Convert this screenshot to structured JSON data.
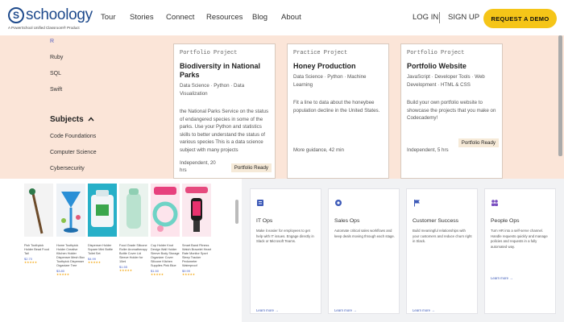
{
  "header": {
    "logo_letter": "S",
    "logo_word": "schoology",
    "logo_sub": "A PowerSchool Unified Classroom® Product",
    "nav": [
      "Tour",
      "Stories",
      "Connect",
      "Resources",
      "Blog",
      "About"
    ],
    "login": "LOG IN",
    "signup": "SIGN UP",
    "cta": "REQUEST A DEMO",
    "cta_color": "#f5c518"
  },
  "filters": {
    "languages": [
      "R",
      "Ruby",
      "SQL",
      "Swift"
    ],
    "subjects_heading": "Subjects",
    "subjects": [
      "Code Foundations",
      "Computer Science",
      "Cybersecurity"
    ]
  },
  "projects": [
    {
      "kind": "Portfolio Project",
      "title": "Biodiversity in National Parks",
      "tags": "Data Science · Python · Data Visualization",
      "desc": "the National Parks Service on the status of endangered species in some of the parks. Use your Python and statistics skills to better understand the status of various species This is a data science subject with many projects",
      "foot": "Independent, 20 hrs",
      "badge": "Portfolio Ready"
    },
    {
      "kind": "Practice Project",
      "title": "Honey Production",
      "tags": "Data Science · Python · Machine Learning",
      "desc": "Fit a line to data about the honeybee population decline in the United States.",
      "foot": "More guidance, 42 min",
      "badge": ""
    },
    {
      "kind": "Portfolio Project",
      "title": "Portfolio Website",
      "tags": "JavaScript · Developer Tools · Web Development · HTML & CSS",
      "desc": "Build your own portfolio website to showcase the projects that you make on Codecademy!",
      "foot": "Independent, 5 hrs",
      "badge": "Portfolio Ready"
    }
  ],
  "products": [
    {
      "title": "Fish Toothpick Holder Bead Food Tail",
      "price": "$2.70",
      "stars": "★★★★★"
    },
    {
      "title": "Home Toothpick Holder Creative Kitchen Holder Dispenser Mesh Box Toothpick Dispenser Organizer Tree",
      "price": "$3.80",
      "stars": "★★★★★"
    },
    {
      "title": "Dispenser Holder Square Mini Bottle Toilet Set",
      "price": "$4.99",
      "stars": "★★★★★"
    },
    {
      "title": "Food Grade Silicone Roller Aromatherapy Bottle Cover Lid Sleeve Holder for 10ml",
      "price": "$1.55",
      "stars": "★★★★★"
    },
    {
      "title": "Cup Holder Knot Design Wall Holder Sleeve Body Storage Organizer Cover Silicone Kitchen Supplies Pink Blue",
      "price": "$1.50",
      "stars": "★★★★★"
    },
    {
      "title": "Smart Band Fitness Watch Bracelet Heart Rate Monitor Sport Sleep Tracker Pedometer Waterproof",
      "price": "$9.99",
      "stars": "★★★★★"
    }
  ],
  "tools": [
    {
      "name": "IT Ops",
      "desc": "Make it easier for employees to get help with IT issues. Engage directly in Slack or Microsoft Teams.",
      "link": "Learn more →",
      "icon": "list-icon",
      "color": "#3d5ab8"
    },
    {
      "name": "Sales Ops",
      "desc": "Automate critical sales workflows and keep deals moving through each stage.",
      "link": "Learn more →",
      "icon": "circle-icon",
      "color": "#3d5ab8"
    },
    {
      "name": "Customer Success",
      "desc": "Build meaningful relationships with your customers and reduce churn right in Slack.",
      "link": "Learn more →",
      "icon": "flag-icon",
      "color": "#3d5ab8"
    },
    {
      "name": "People Ops",
      "desc": "Turn HR into a self-serve channel. Handle requests quickly and manage policies and requests in a fully automated way.",
      "link": "Learn more →",
      "icon": "people-icon",
      "color": "#7a4fc0"
    }
  ]
}
